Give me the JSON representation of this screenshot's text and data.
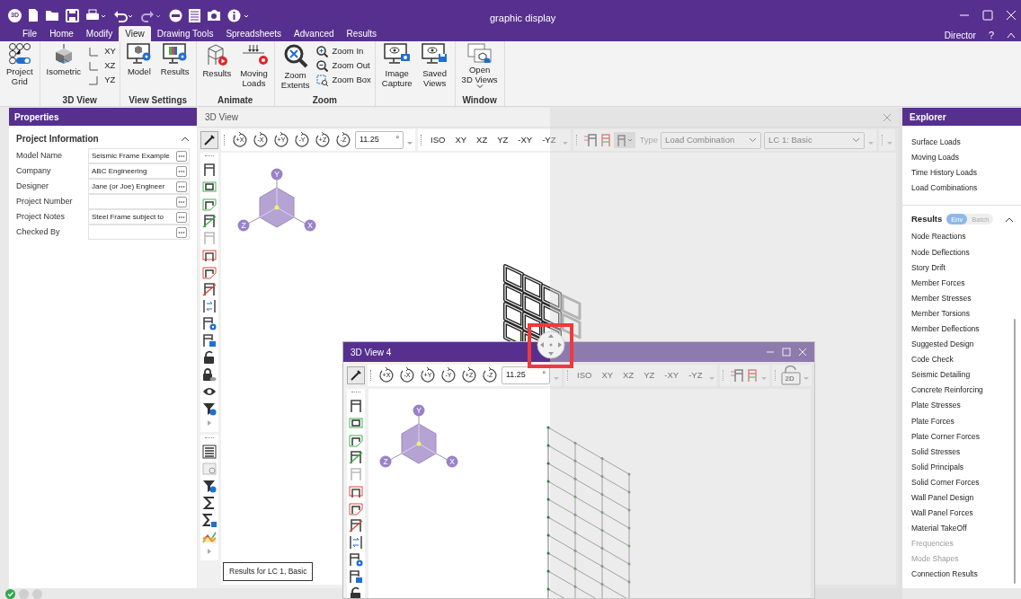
{
  "window": {
    "title": "graphic display",
    "app_badge": "3D"
  },
  "ribbon_tabs": [
    {
      "label": "File",
      "selected": false
    },
    {
      "label": "Home",
      "selected": false
    },
    {
      "label": "Modify",
      "selected": false
    },
    {
      "label": "View",
      "selected": true
    },
    {
      "label": "Drawing Tools",
      "selected": false
    },
    {
      "label": "Spreadsheets",
      "selected": false
    },
    {
      "label": "Advanced",
      "selected": false
    },
    {
      "label": "Results",
      "selected": false
    }
  ],
  "account": {
    "user": "Director",
    "help": "?"
  },
  "ribbon_groups": [
    {
      "items": [
        {
          "kind": "large",
          "lines": [
            "Project",
            "Grid"
          ]
        }
      ]
    },
    {
      "title": "3D View",
      "items": [
        {
          "kind": "large",
          "lines": [
            "Isometric"
          ]
        },
        {
          "kind": "small",
          "label": "XY"
        },
        {
          "kind": "small",
          "label": "XZ"
        },
        {
          "kind": "small",
          "label": "YZ"
        }
      ]
    },
    {
      "title": "View Settings",
      "items": [
        {
          "kind": "large",
          "lines": [
            "Model"
          ]
        },
        {
          "kind": "large",
          "lines": [
            "Results"
          ]
        }
      ]
    },
    {
      "title": "Animate",
      "items": [
        {
          "kind": "large",
          "lines": [
            "Results"
          ]
        },
        {
          "kind": "large",
          "lines": [
            "Moving",
            "Loads"
          ]
        }
      ]
    },
    {
      "title": "Zoom",
      "items": [
        {
          "kind": "large",
          "lines": [
            "Zoom",
            "Extents"
          ]
        },
        {
          "kind": "small",
          "label": "Zoom In"
        },
        {
          "kind": "small",
          "label": "Zoom Out"
        },
        {
          "kind": "small",
          "label": "Zoom Box"
        }
      ]
    },
    {
      "items": [
        {
          "kind": "large",
          "lines": [
            "Image",
            "Capture"
          ]
        },
        {
          "kind": "large",
          "lines": [
            "Saved",
            "Views"
          ]
        }
      ]
    },
    {
      "title": "Window",
      "items": [
        {
          "kind": "dropdown",
          "lines": [
            "Open",
            "3D Views"
          ]
        }
      ]
    }
  ],
  "properties": {
    "title": "Properties",
    "section": {
      "title": "Project Information",
      "expanded": true,
      "rows": [
        {
          "label": "Model Name",
          "value": "Seismic Frame Example"
        },
        {
          "label": "Company",
          "value": "ABC Engineering"
        },
        {
          "label": "Designer",
          "value": "Jane (or Joe) Engineer"
        },
        {
          "label": "Project Number",
          "value": ""
        },
        {
          "label": "Project Notes",
          "value": "Steel Frame subject to"
        },
        {
          "label": "Checked By",
          "value": ""
        }
      ]
    }
  },
  "view_3d": {
    "title": "3D View",
    "rotate_buttons": [
      "+X",
      "-X",
      "+Y",
      "-Y",
      "+Z",
      "-Z"
    ],
    "angle": {
      "value": "11.25",
      "unit": "°"
    },
    "view_buttons": [
      "ISO",
      "XY",
      "XZ",
      "YZ",
      "-XY",
      "-YZ"
    ],
    "type_label": "Type",
    "type_dropdown": "Load Combination",
    "case_dropdown": "LC 1: Basic",
    "axes": [
      "Y",
      "Z",
      "X"
    ],
    "tooltip": "Results for LC 1, Basic"
  },
  "view_3d_4": {
    "title": "3D View 4",
    "rotate_buttons": [
      "+X",
      "-X",
      "+Y",
      "-Y",
      "+Z",
      "-Z"
    ],
    "angle": {
      "value": "11.25",
      "unit": "°"
    },
    "view_buttons": [
      "ISO",
      "XY",
      "XZ",
      "YZ",
      "-XY",
      "-YZ"
    ],
    "mode_badge": "2D",
    "axes": [
      "Y",
      "Z",
      "X"
    ]
  },
  "explorer": {
    "title": "Explorer",
    "items": [
      "Surface Loads",
      "Moving Loads",
      "Time History Loads",
      "Load Combinations"
    ],
    "results": {
      "title": "Results",
      "expanded": true,
      "modes": [
        {
          "label": "Env",
          "selected": true
        },
        {
          "label": "Batch",
          "selected": false
        }
      ],
      "items": [
        {
          "label": "Node Reactions",
          "disabled": false
        },
        {
          "label": "Node Deflections",
          "disabled": false
        },
        {
          "label": "Story Drift",
          "disabled": false
        },
        {
          "label": "Member Forces",
          "disabled": false
        },
        {
          "label": "Member Stresses",
          "disabled": false
        },
        {
          "label": "Member Torsions",
          "disabled": false
        },
        {
          "label": "Member Deflections",
          "disabled": false
        },
        {
          "label": "Suggested Design",
          "disabled": false
        },
        {
          "label": "Code Check",
          "disabled": false
        },
        {
          "label": "Seismic Detailing",
          "disabled": false
        },
        {
          "label": "Concrete Reinforcing",
          "disabled": false
        },
        {
          "label": "Plate Stresses",
          "disabled": false
        },
        {
          "label": "Plate Forces",
          "disabled": false
        },
        {
          "label": "Plate Corner Forces",
          "disabled": false
        },
        {
          "label": "Solid Stresses",
          "disabled": false
        },
        {
          "label": "Solid Principals",
          "disabled": false
        },
        {
          "label": "Solid Corner Forces",
          "disabled": false
        },
        {
          "label": "Wall Panel Design",
          "disabled": false
        },
        {
          "label": "Wall Panel Forces",
          "disabled": false
        },
        {
          "label": "Material TakeOff",
          "disabled": false
        },
        {
          "label": "Frequencies",
          "disabled": true
        },
        {
          "label": "Mode Shapes",
          "disabled": true
        },
        {
          "label": "Connection Results",
          "disabled": false
        }
      ]
    }
  }
}
